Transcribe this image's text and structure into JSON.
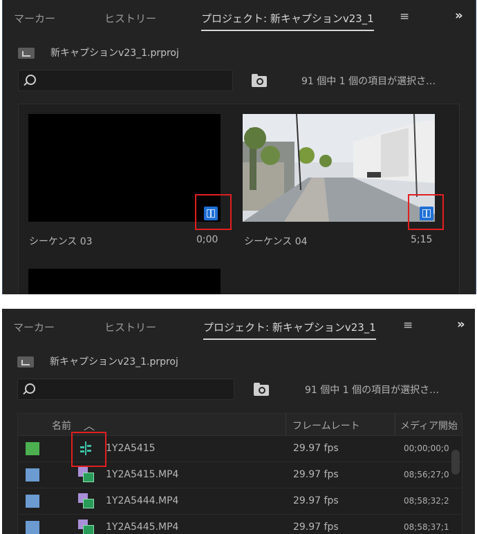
{
  "panel_top": {
    "tabs": {
      "markers": "マーカー",
      "history": "ヒストリー",
      "project": "プロジェクト: 新キャプションv23_1",
      "menu_icon": "≡",
      "overflow_icon": "»"
    },
    "project_file": "新キャプションv23_1.prproj",
    "search_placeholder": "",
    "item_count": "91 個中 1 個の項目が選択さ…",
    "thumbnails": [
      {
        "name": "シーケンス 03",
        "duration": "0;00",
        "preview": "black"
      },
      {
        "name": "シーケンス 04",
        "duration": "5;15",
        "preview": "street-photo"
      }
    ]
  },
  "panel_bottom": {
    "tabs": {
      "markers": "マーカー",
      "history": "ヒストリー",
      "project": "プロジェクト: 新キャプションv23_1",
      "menu_icon": "≡",
      "overflow_icon": "»"
    },
    "project_file": "新キャプションv23_1.prproj",
    "search_placeholder": "",
    "item_count": "91 個中 1 個の項目が選択さ…",
    "columns": {
      "name": "名前",
      "framerate": "フレームレート",
      "media_start": "メディア開始"
    },
    "rows": [
      {
        "color": "#4caf50",
        "icon": "sequence-icon",
        "name": "1Y2A5415",
        "fps": "29.97 fps",
        "timecode": "00;00;00;0"
      },
      {
        "color": "#6b9bd1",
        "icon": "clip-icon",
        "name": "1Y2A5415.MP4",
        "fps": "29.97 fps",
        "timecode": "08;56;27;0"
      },
      {
        "color": "#6b9bd1",
        "icon": "clip-icon",
        "name": "1Y2A5444.MP4",
        "fps": "29.97 fps",
        "timecode": "08;58;32;2"
      },
      {
        "color": "#6b9bd1",
        "icon": "clip-icon",
        "name": "1Y2A5445.MP4",
        "fps": "29.97 fps",
        "timecode": "08;58;37;1"
      }
    ]
  },
  "colors": {
    "panel_bg": "#232323",
    "highlight_red": "#e21f1f",
    "sequence_blue": "#1f6fd6"
  }
}
